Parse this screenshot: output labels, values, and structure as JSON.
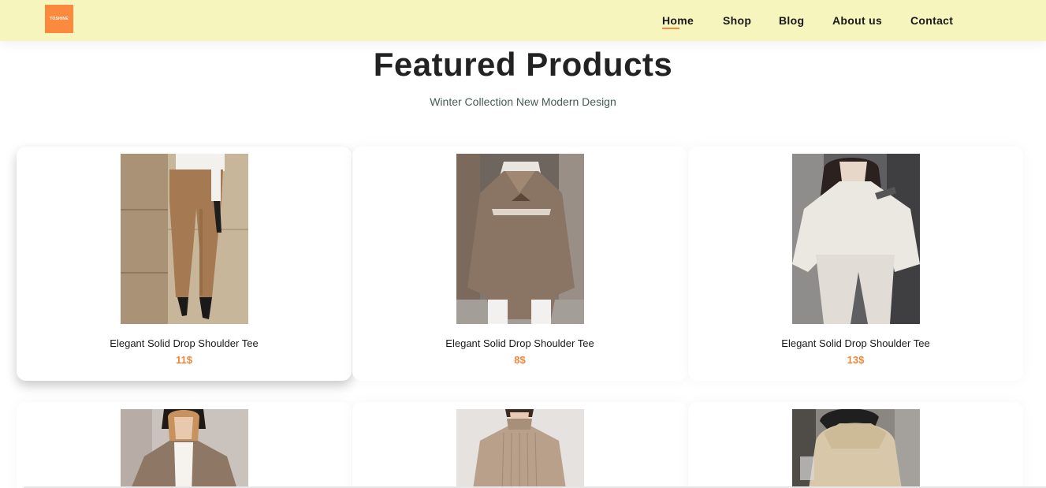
{
  "header": {
    "logo_text": "TOSHINE",
    "nav": [
      {
        "label": "Home",
        "active": true
      },
      {
        "label": "Shop",
        "active": false
      },
      {
        "label": "Blog",
        "active": false
      },
      {
        "label": "About us",
        "active": false
      },
      {
        "label": "Contact",
        "active": false
      }
    ]
  },
  "section": {
    "title": "Featured Products",
    "subtitle": "Winter Collection New Modern Design"
  },
  "products": [
    {
      "name": "Elegant Solid Drop Shoulder Tee",
      "price": "11$",
      "image": "tan-trousers-photo"
    },
    {
      "name": "Elegant Solid Drop Shoulder Tee",
      "price": "8$",
      "image": "brown-hoodie-photo"
    },
    {
      "name": "Elegant Solid Drop Shoulder Tee",
      "price": "13$",
      "image": "grey-sweatsuit-photo"
    },
    {
      "image": "plaid-blazer-photo"
    },
    {
      "image": "ribbed-turtleneck-photo"
    },
    {
      "image": "beige-hoodie-photo"
    }
  ],
  "colors": {
    "header_bg": "#f5f5bd",
    "accent": "#fb8a3e",
    "price": "#ef8637"
  }
}
